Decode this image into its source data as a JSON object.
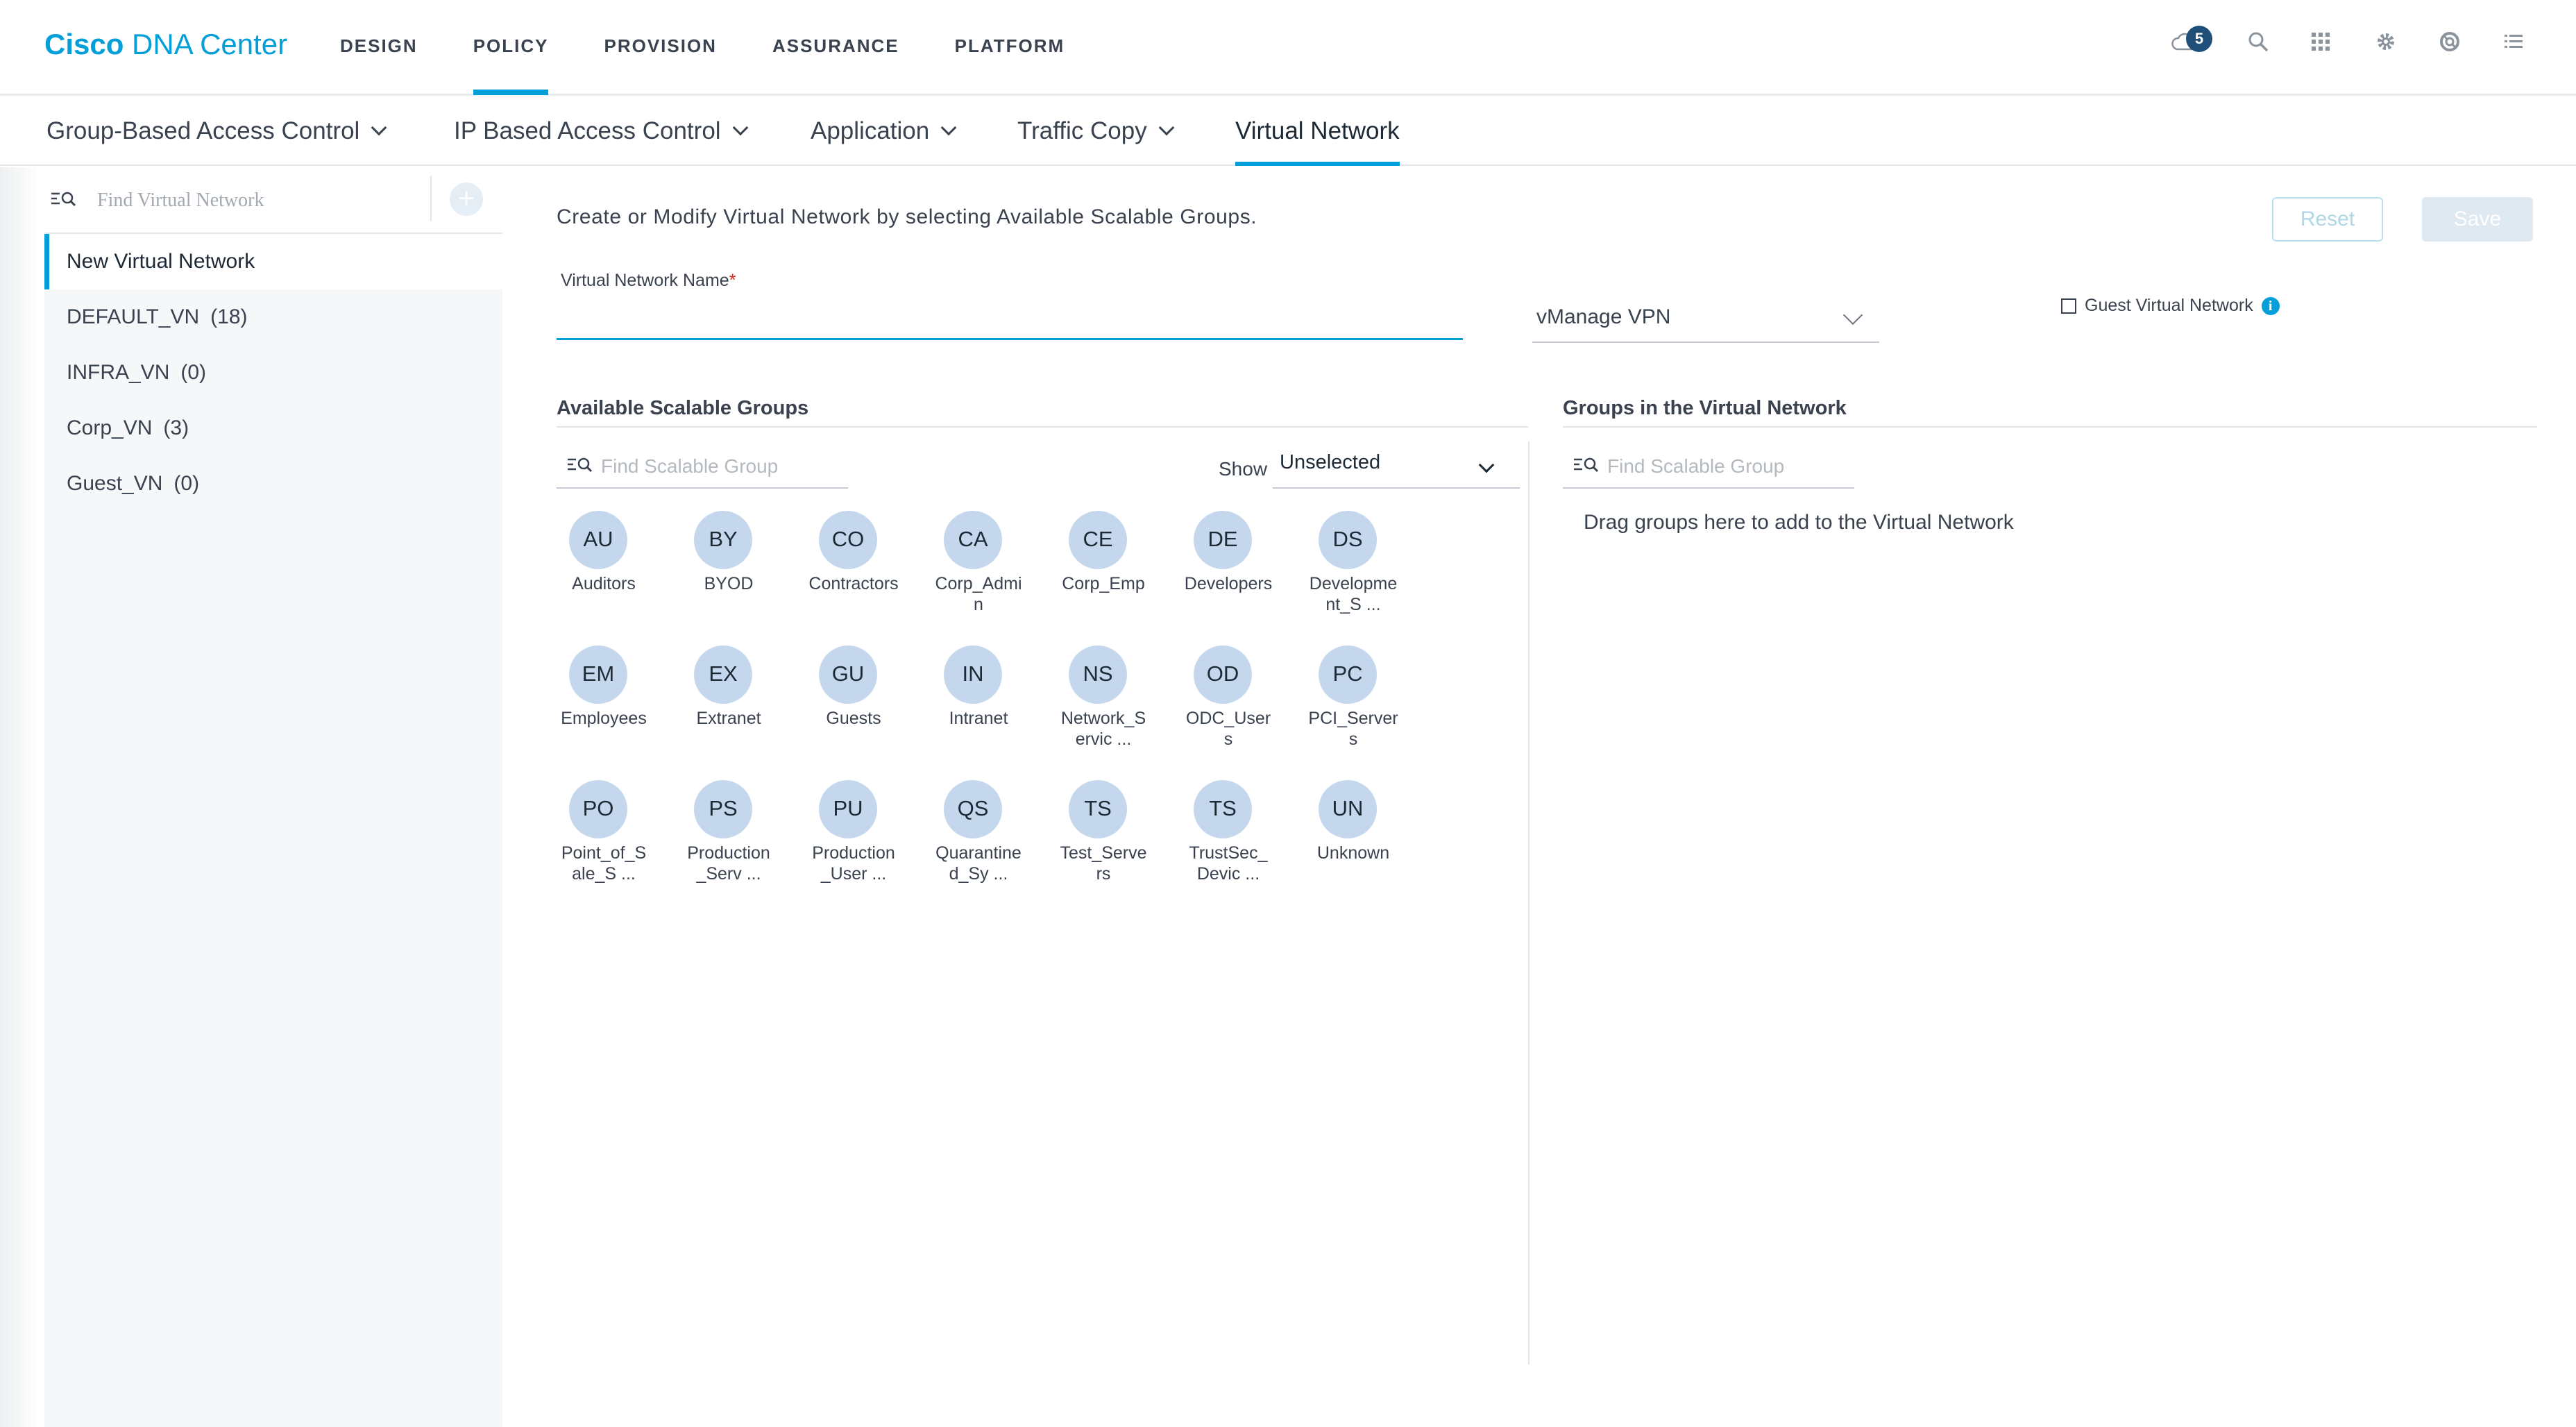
{
  "header": {
    "brand_bold": "Cisco",
    "brand_rest": " DNA Center",
    "nav": [
      {
        "label": "DESIGN"
      },
      {
        "label": "POLICY"
      },
      {
        "label": "PROVISION"
      },
      {
        "label": "ASSURANCE"
      },
      {
        "label": "PLATFORM"
      }
    ],
    "active_nav": "POLICY",
    "notification_count": "5",
    "icons": [
      "cloud-notification-icon",
      "search-icon",
      "apps-grid-icon",
      "gear-icon",
      "help-lifebuoy-icon",
      "menu-list-icon"
    ]
  },
  "subnav": {
    "tabs": [
      {
        "label": "Group-Based Access Control",
        "has_dropdown": true
      },
      {
        "label": "IP Based Access Control",
        "has_dropdown": true
      },
      {
        "label": "Application",
        "has_dropdown": true
      },
      {
        "label": "Traffic Copy",
        "has_dropdown": true
      },
      {
        "label": "Virtual Network",
        "has_dropdown": false
      }
    ],
    "active_tab": "Virtual Network"
  },
  "sidebar": {
    "search_placeholder": "Find Virtual Network",
    "items": [
      {
        "label": "New Virtual Network",
        "count": ""
      },
      {
        "label": "DEFAULT_VN",
        "count": "(18)"
      },
      {
        "label": "INFRA_VN",
        "count": "(0)"
      },
      {
        "label": "Corp_VN",
        "count": "(3)"
      },
      {
        "label": "Guest_VN",
        "count": "(0)"
      }
    ]
  },
  "main": {
    "intro": "Create or Modify Virtual Network by selecting Available Scalable Groups.",
    "reset_label": "Reset",
    "save_label": "Save",
    "name_label": "Virtual Network Name",
    "required_mark": "*",
    "name_value": "",
    "vpn_select_value": "vManage VPN",
    "guest_label": "Guest Virtual Network",
    "guest_checked": false,
    "info_glyph": "i",
    "available": {
      "title": "Available Scalable Groups",
      "search_placeholder": "Find Scalable Group",
      "show_label": "Show",
      "show_value": "Unselected",
      "groups": [
        {
          "abbr": "AU",
          "name": "Auditors"
        },
        {
          "abbr": "BY",
          "name": "BYOD"
        },
        {
          "abbr": "CO",
          "name": "Contractors"
        },
        {
          "abbr": "CA",
          "name": "Corp_Admin"
        },
        {
          "abbr": "CE",
          "name": "Corp_Emp"
        },
        {
          "abbr": "DE",
          "name": "Developers"
        },
        {
          "abbr": "DS",
          "name": "Development_S ..."
        },
        {
          "abbr": "EM",
          "name": "Employees"
        },
        {
          "abbr": "EX",
          "name": "Extranet"
        },
        {
          "abbr": "GU",
          "name": "Guests"
        },
        {
          "abbr": "IN",
          "name": "Intranet"
        },
        {
          "abbr": "NS",
          "name": "Network_Servic ..."
        },
        {
          "abbr": "OD",
          "name": "ODC_Users"
        },
        {
          "abbr": "PC",
          "name": "PCI_Servers"
        },
        {
          "abbr": "PO",
          "name": "Point_of_Sale_S ..."
        },
        {
          "abbr": "PS",
          "name": "Production_Serv ..."
        },
        {
          "abbr": "PU",
          "name": "Production_User ..."
        },
        {
          "abbr": "QS",
          "name": "Quarantined_Sy ..."
        },
        {
          "abbr": "TS",
          "name": "Test_Servers"
        },
        {
          "abbr": "TS",
          "name": "TrustSec_Devic ..."
        },
        {
          "abbr": "UN",
          "name": "Unknown"
        }
      ]
    },
    "in_network": {
      "title": "Groups in the Virtual Network",
      "search_placeholder": "Find Scalable Group",
      "drop_hint": "Drag groups here to add to the Virtual Network"
    }
  },
  "colors": {
    "accent": "#049fd9",
    "group_circle": "#c5d7ed",
    "badge": "#1f4e79",
    "required": "#e2231a"
  }
}
